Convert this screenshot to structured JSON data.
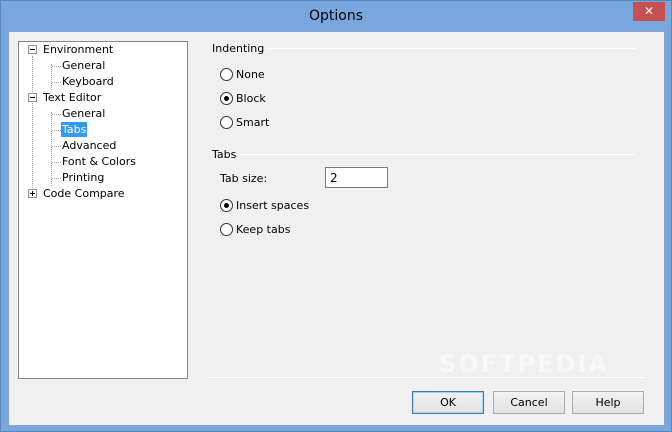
{
  "window": {
    "title": "Options",
    "close_symbol": "✕"
  },
  "tree": {
    "environment": {
      "label": "Environment",
      "expander": "-",
      "children": [
        "General",
        "Keyboard"
      ]
    },
    "text_editor": {
      "label": "Text Editor",
      "expander": "-",
      "children": [
        "General",
        "Tabs",
        "Advanced",
        "Font & Colors",
        "Printing"
      ],
      "selected": "Tabs"
    },
    "code_compare": {
      "label": "Code Compare",
      "expander": "+"
    }
  },
  "indenting": {
    "title": "Indenting",
    "options": [
      {
        "label": "None",
        "checked": false
      },
      {
        "label": "Block",
        "checked": true
      },
      {
        "label": "Smart",
        "checked": false
      }
    ]
  },
  "tabs": {
    "title": "Tabs",
    "tab_size_label": "Tab size:",
    "tab_size_value": "2",
    "options": [
      {
        "label": "Insert spaces",
        "checked": true
      },
      {
        "label": "Keep tabs",
        "checked": false
      }
    ]
  },
  "buttons": {
    "ok": "OK",
    "cancel": "Cancel",
    "help": "Help"
  },
  "watermark": "SOFTPEDIA"
}
